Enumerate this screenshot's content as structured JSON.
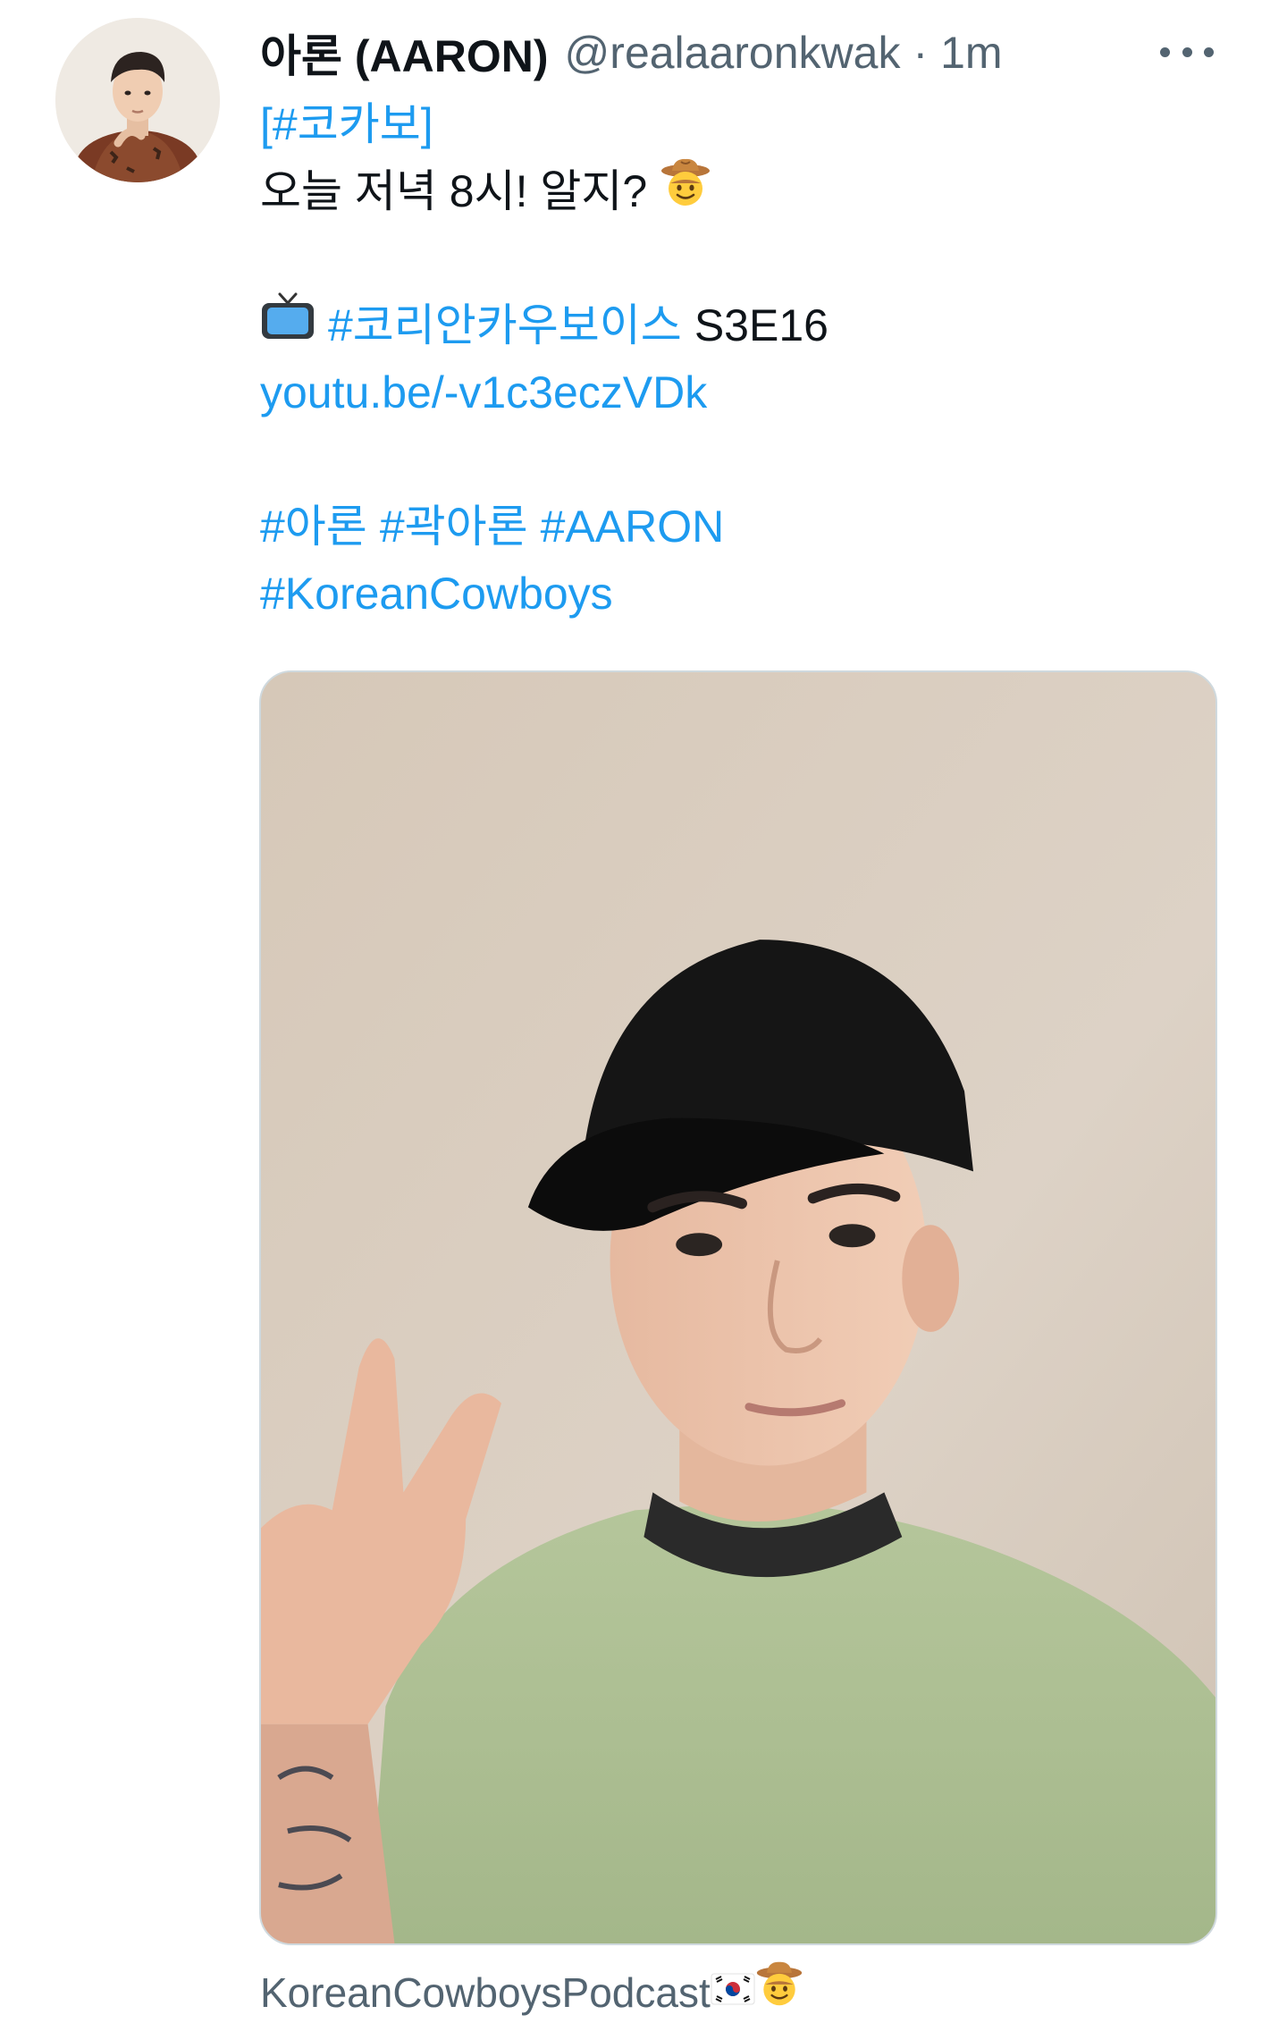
{
  "tweet": {
    "display_name": "아론 (AARON)",
    "handle": "@realaaronkwak",
    "separator": "·",
    "time": "1m",
    "lines": {
      "hashtag_kokabo": "[#코카보]",
      "tonight": "오늘 저녁 8시! 알지?",
      "hashtag_show": "#코리안카우보이스",
      "episode": "S3E16",
      "link": "youtu.be/-v1c3eczVDk",
      "tag_aaron_kr": "#아론",
      "tag_kwak_aaron": "#곽아론",
      "tag_aaron": "#AARON",
      "tag_korean_cowboys": "#KoreanCowboys"
    },
    "source": "KoreanCowboysPodcast"
  },
  "colors": {
    "link": "#1d9bf0",
    "secondary_text": "#536471",
    "primary_text": "#0f1419",
    "media_border": "#cfd9de"
  },
  "icons": {
    "more": "more-horizontal-icon",
    "cowboy": "cowboy-face-emoji-icon",
    "tv": "television-emoji-icon",
    "flag": "south-korea-flag-icon"
  }
}
